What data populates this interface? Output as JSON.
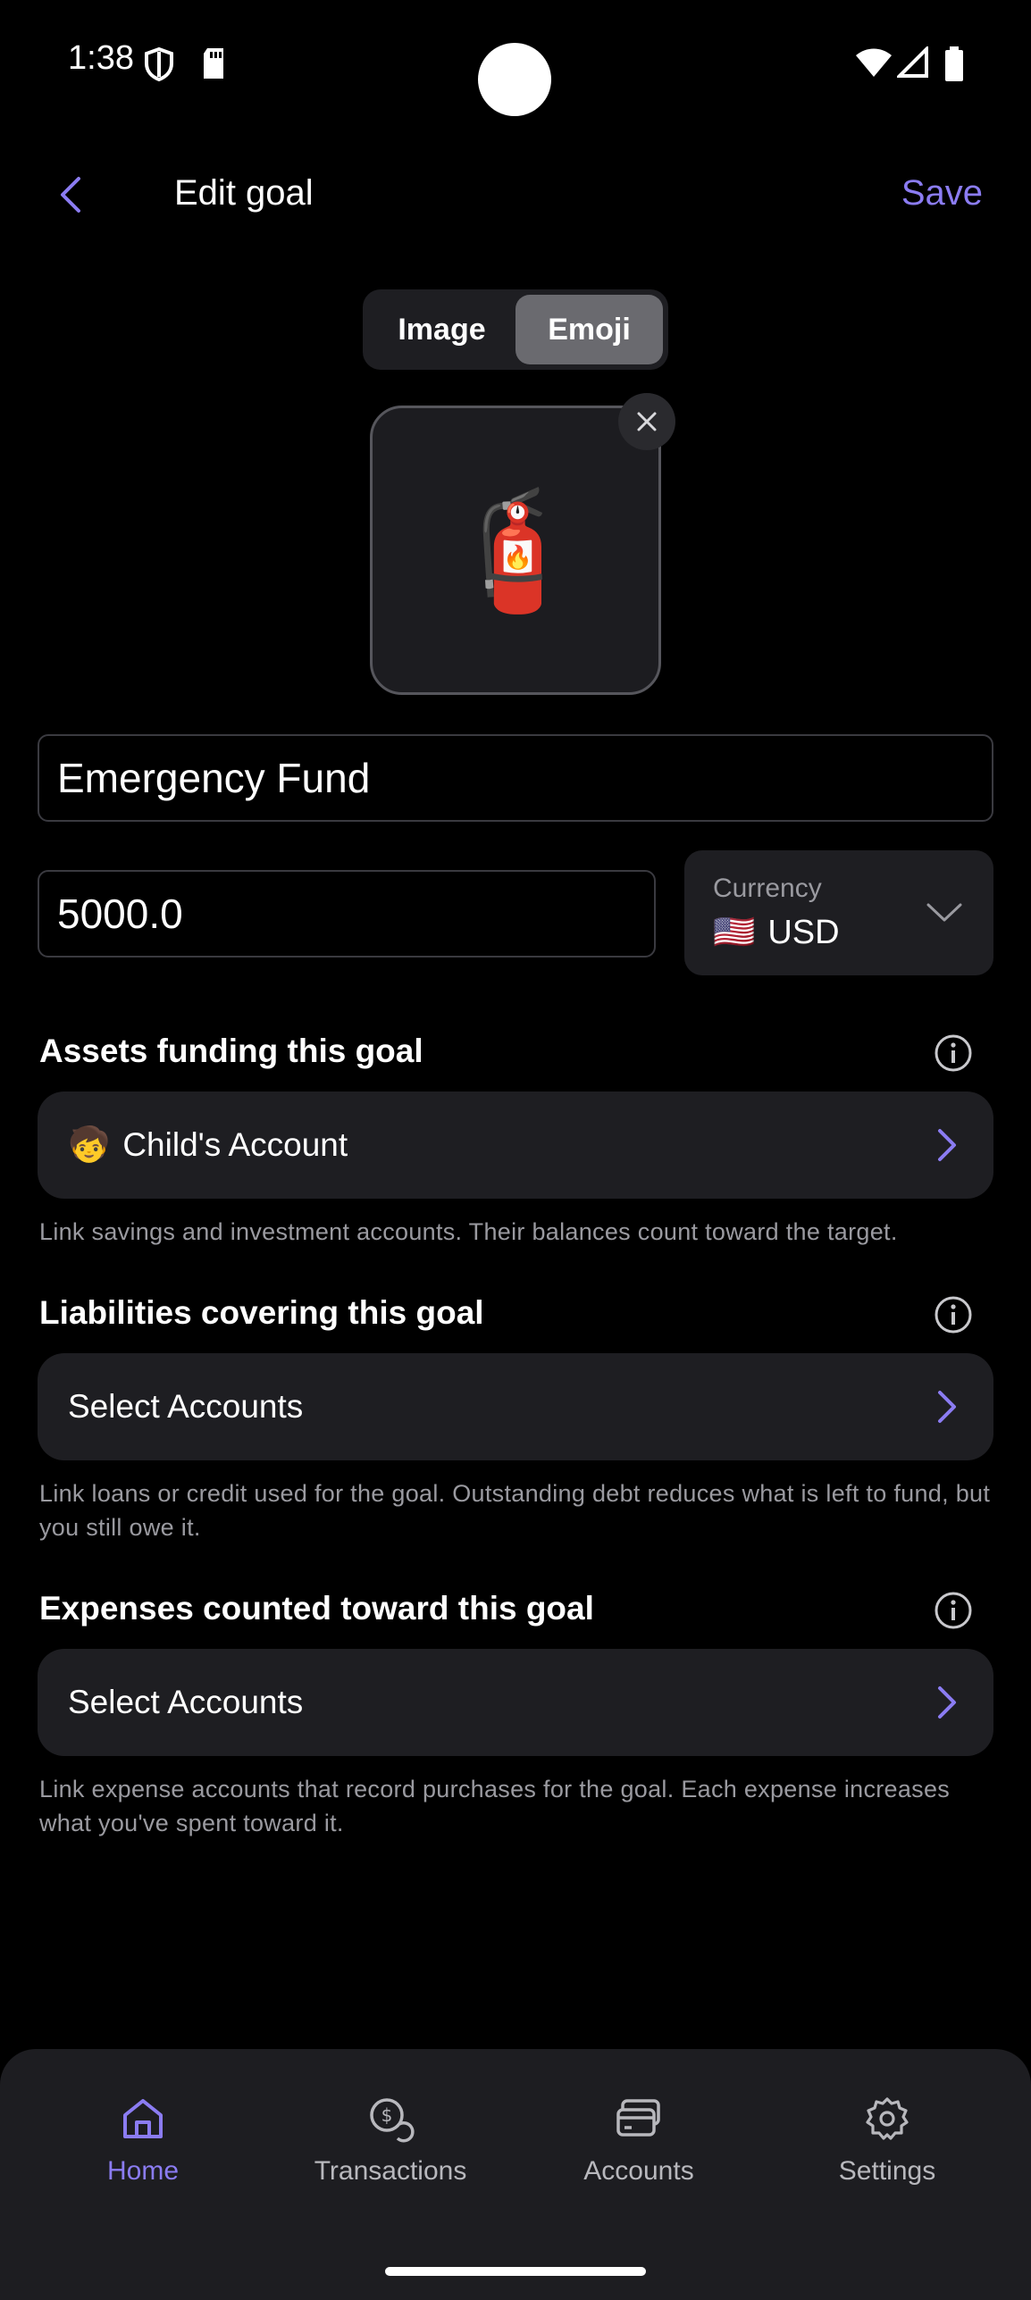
{
  "status_bar": {
    "time": "1:38"
  },
  "header": {
    "title": "Edit goal",
    "save_label": "Save"
  },
  "icon_picker": {
    "tabs": [
      {
        "label": "Image",
        "active": false
      },
      {
        "label": "Emoji",
        "active": true
      }
    ],
    "emoji": "🧯"
  },
  "form": {
    "name_value": "Emergency Fund",
    "amount_value": "5000.0",
    "currency": {
      "label": "Currency",
      "flag": "🇺🇸",
      "value": "USD"
    }
  },
  "sections": {
    "assets": {
      "title": "Assets funding this goal",
      "row_emoji": "🧒",
      "row_label": "Child's Account",
      "helper": "Link savings and investment accounts. Their balances count toward the target."
    },
    "liabilities": {
      "title": "Liabilities covering this goal",
      "row_label": "Select Accounts",
      "helper": "Link loans or credit used for the goal. Outstanding debt reduces what is left to fund, but you still owe it."
    },
    "expenses": {
      "title": "Expenses counted toward this goal",
      "row_label": "Select Accounts",
      "helper": "Link expense accounts that record purchases for the goal. Each expense increases what you've spent toward it."
    }
  },
  "bottom_nav": {
    "items": [
      {
        "label": "Home",
        "icon": "home-icon",
        "active": true
      },
      {
        "label": "Transactions",
        "icon": "transactions-icon",
        "active": false
      },
      {
        "label": "Accounts",
        "icon": "accounts-icon",
        "active": false
      },
      {
        "label": "Settings",
        "icon": "settings-icon",
        "active": false
      }
    ]
  },
  "colors": {
    "accent": "#8b7cf2",
    "surface": "#1e1e22",
    "background": "#000000",
    "muted_text": "#9a9aa0"
  }
}
